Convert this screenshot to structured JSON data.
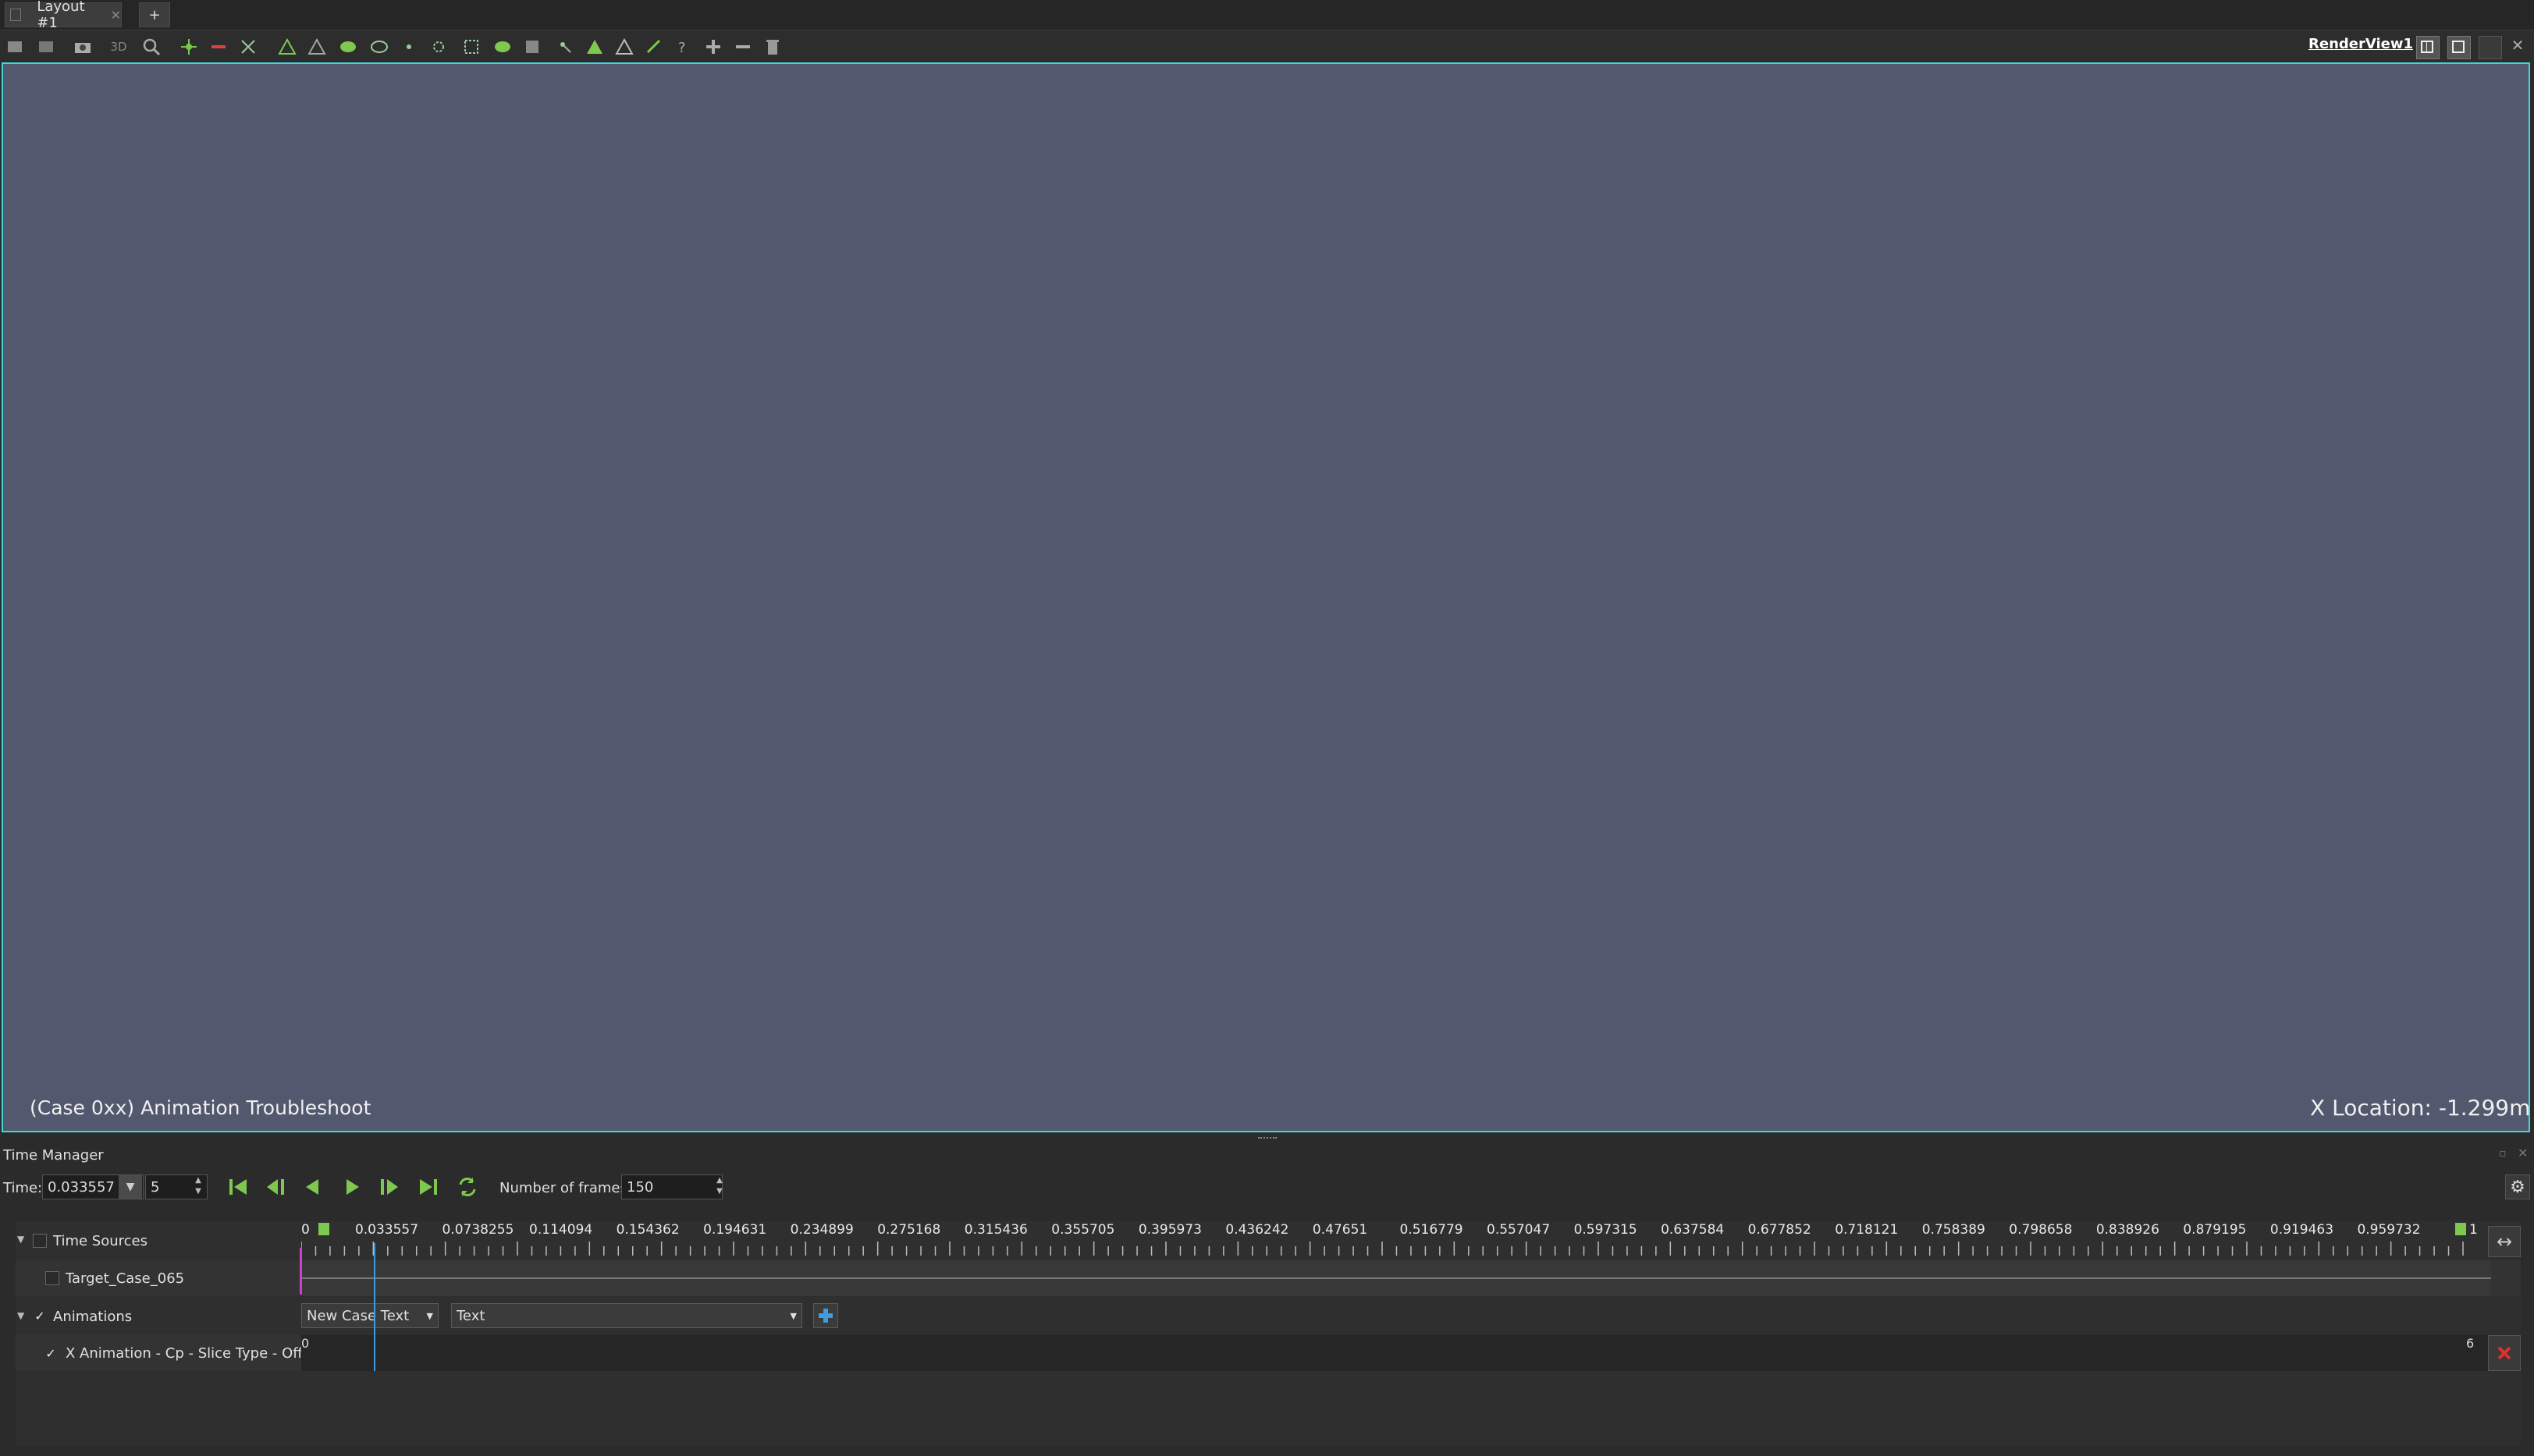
{
  "tabs": {
    "layout_tab": "Layout #1",
    "add_tab": "+"
  },
  "toolbar": {
    "reset_camera": "reset-camera-icon",
    "view_3d": "3D",
    "render_view_name": "RenderView1"
  },
  "render_view": {
    "background_color": "#52586e",
    "border_color": "#3fd7d7",
    "left_text": "(Case 0xx) Animation Troubleshoot",
    "right_text": "X Location: -1.299m"
  },
  "time_manager": {
    "title": "Time Manager",
    "time_label": "Time:",
    "time_value": "0.033557",
    "step_value": "5",
    "frames_label": "Number of frames",
    "frames_value": "150",
    "timeline_ticks": [
      "0",
      "0.033557",
      "0.0738255",
      "0.114094",
      "0.154362",
      "0.194631",
      "0.234899",
      "0.275168",
      "0.315436",
      "0.355705",
      "0.395973",
      "0.436242",
      "0.47651",
      "0.516779",
      "0.557047",
      "0.597315",
      "0.637584",
      "0.677852",
      "0.718121",
      "0.758389",
      "0.798658",
      "0.838926",
      "0.879195",
      "0.919463",
      "0.959732",
      "1"
    ],
    "time_sources_label": "Time Sources",
    "source_item": "Target_Case_065",
    "animations_label": "Animations",
    "new_case_combo": "New Case Text",
    "type_combo": "Text",
    "track_label": "X Animation - Cp - Slice Type - Offset",
    "track_start": "0",
    "track_end": "6",
    "current_time_fraction": 0.033557
  }
}
